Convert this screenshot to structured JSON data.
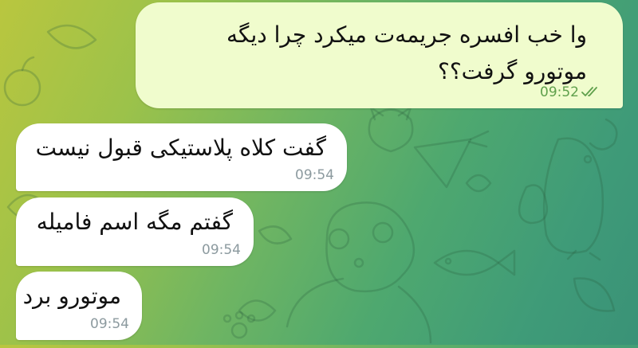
{
  "colors": {
    "outgoing_bubble": "#f0fccd",
    "incoming_bubble": "#ffffff",
    "outgoing_time": "#5fa04c",
    "incoming_time": "#8c9a9f"
  },
  "messages": [
    {
      "direction": "outgoing",
      "text": "وا خب افسره جریمه‌ت میکرد چرا دیگه موتورو گرفت؟؟",
      "time": "09:52",
      "status_icon": "double-check-icon"
    },
    {
      "direction": "incoming",
      "text": "گفت کلاه پلاستیکی قبول نیست",
      "time": "09:54"
    },
    {
      "direction": "incoming",
      "text": "گفتم مگه اسم فامیله",
      "time": "09:54"
    },
    {
      "direction": "incoming",
      "text": "موتورو برد",
      "time": "09:54"
    }
  ]
}
